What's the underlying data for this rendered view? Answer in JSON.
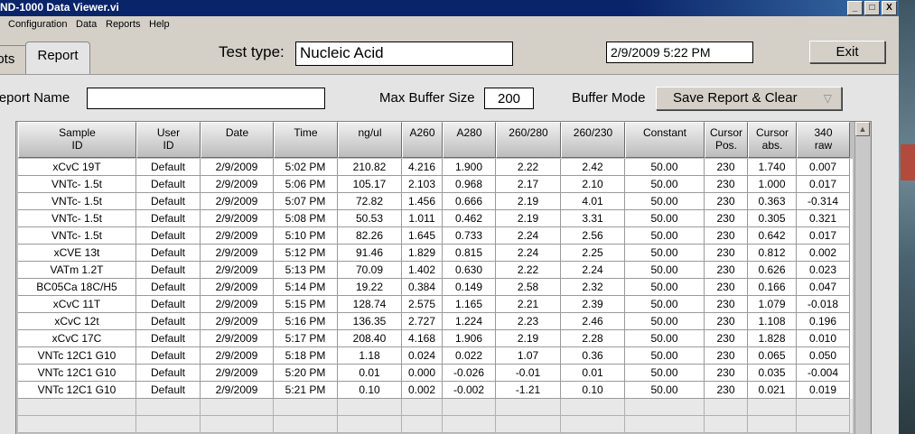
{
  "window": {
    "title": "ND-1000 Data Viewer.vi"
  },
  "title_controls": {
    "minimize": "_",
    "maximize": "□",
    "close": "X"
  },
  "menu": [
    "Configuration",
    "Data",
    "Reports",
    "Help"
  ],
  "tabs": [
    "Plots",
    "Report"
  ],
  "test_type": {
    "label": "Test type:",
    "value": "Nucleic Acid"
  },
  "datetime": "2/9/2009  5:22 PM",
  "exit_label": "Exit",
  "report_name": {
    "label": "Report Name",
    "value": ""
  },
  "max_buffer": {
    "label": "Max Buffer Size",
    "value": "200"
  },
  "buffer_mode": {
    "label": "Buffer Mode",
    "value": "Save Report & Clear"
  },
  "columns": [
    [
      "Sample",
      "ID"
    ],
    [
      "User",
      "ID"
    ],
    [
      "Date",
      ""
    ],
    [
      "Time",
      ""
    ],
    [
      "ng/ul",
      ""
    ],
    [
      "A260",
      ""
    ],
    [
      "A280",
      ""
    ],
    [
      "260/280",
      ""
    ],
    [
      "260/230",
      ""
    ],
    [
      "Constant",
      ""
    ],
    [
      "Cursor",
      "Pos."
    ],
    [
      "Cursor",
      "abs."
    ],
    [
      "340",
      "raw"
    ]
  ],
  "rows": [
    [
      "xCvC 19T",
      "Default",
      "2/9/2009",
      "5:02 PM",
      "210.82",
      "4.216",
      "1.900",
      "2.22",
      "2.42",
      "50.00",
      "230",
      "1.740",
      "0.007"
    ],
    [
      "VNTc- 1.5t",
      "Default",
      "2/9/2009",
      "5:06 PM",
      "105.17",
      "2.103",
      "0.968",
      "2.17",
      "2.10",
      "50.00",
      "230",
      "1.000",
      "0.017"
    ],
    [
      "VNTc- 1.5t",
      "Default",
      "2/9/2009",
      "5:07 PM",
      "72.82",
      "1.456",
      "0.666",
      "2.19",
      "4.01",
      "50.00",
      "230",
      "0.363",
      "-0.314"
    ],
    [
      "VNTc- 1.5t",
      "Default",
      "2/9/2009",
      "5:08 PM",
      "50.53",
      "1.011",
      "0.462",
      "2.19",
      "3.31",
      "50.00",
      "230",
      "0.305",
      "0.321"
    ],
    [
      "VNTc- 1.5t",
      "Default",
      "2/9/2009",
      "5:10 PM",
      "82.26",
      "1.645",
      "0.733",
      "2.24",
      "2.56",
      "50.00",
      "230",
      "0.642",
      "0.017"
    ],
    [
      "xCVE 13t",
      "Default",
      "2/9/2009",
      "5:12 PM",
      "91.46",
      "1.829",
      "0.815",
      "2.24",
      "2.25",
      "50.00",
      "230",
      "0.812",
      "0.002"
    ],
    [
      "VATm 1.2T",
      "Default",
      "2/9/2009",
      "5:13 PM",
      "70.09",
      "1.402",
      "0.630",
      "2.22",
      "2.24",
      "50.00",
      "230",
      "0.626",
      "0.023"
    ],
    [
      "BC05Ca 18C/H5",
      "Default",
      "2/9/2009",
      "5:14 PM",
      "19.22",
      "0.384",
      "0.149",
      "2.58",
      "2.32",
      "50.00",
      "230",
      "0.166",
      "0.047"
    ],
    [
      "xCvC 11T",
      "Default",
      "2/9/2009",
      "5:15 PM",
      "128.74",
      "2.575",
      "1.165",
      "2.21",
      "2.39",
      "50.00",
      "230",
      "1.079",
      "-0.018"
    ],
    [
      "xCvC 12t",
      "Default",
      "2/9/2009",
      "5:16 PM",
      "136.35",
      "2.727",
      "1.224",
      "2.23",
      "2.46",
      "50.00",
      "230",
      "1.108",
      "0.196"
    ],
    [
      "xCvC 17C",
      "Default",
      "2/9/2009",
      "5:17 PM",
      "208.40",
      "4.168",
      "1.906",
      "2.19",
      "2.28",
      "50.00",
      "230",
      "1.828",
      "0.010"
    ],
    [
      "VNTc 12C1 G10",
      "Default",
      "2/9/2009",
      "5:18 PM",
      "1.18",
      "0.024",
      "0.022",
      "1.07",
      "0.36",
      "50.00",
      "230",
      "0.065",
      "0.050"
    ],
    [
      "VNTc 12C1 G10",
      "Default",
      "2/9/2009",
      "5:20 PM",
      "0.01",
      "0.000",
      "-0.026",
      "-0.01",
      "0.01",
      "50.00",
      "230",
      "0.035",
      "-0.004"
    ],
    [
      "VNTc 12C1 G10",
      "Default",
      "2/9/2009",
      "5:21 PM",
      "0.10",
      "0.002",
      "-0.002",
      "-1.21",
      "0.10",
      "50.00",
      "230",
      "0.021",
      "0.019"
    ]
  ],
  "icons": {
    "dropdown": "triangle-down-icon",
    "scroll_up": "triangle-up-icon"
  }
}
